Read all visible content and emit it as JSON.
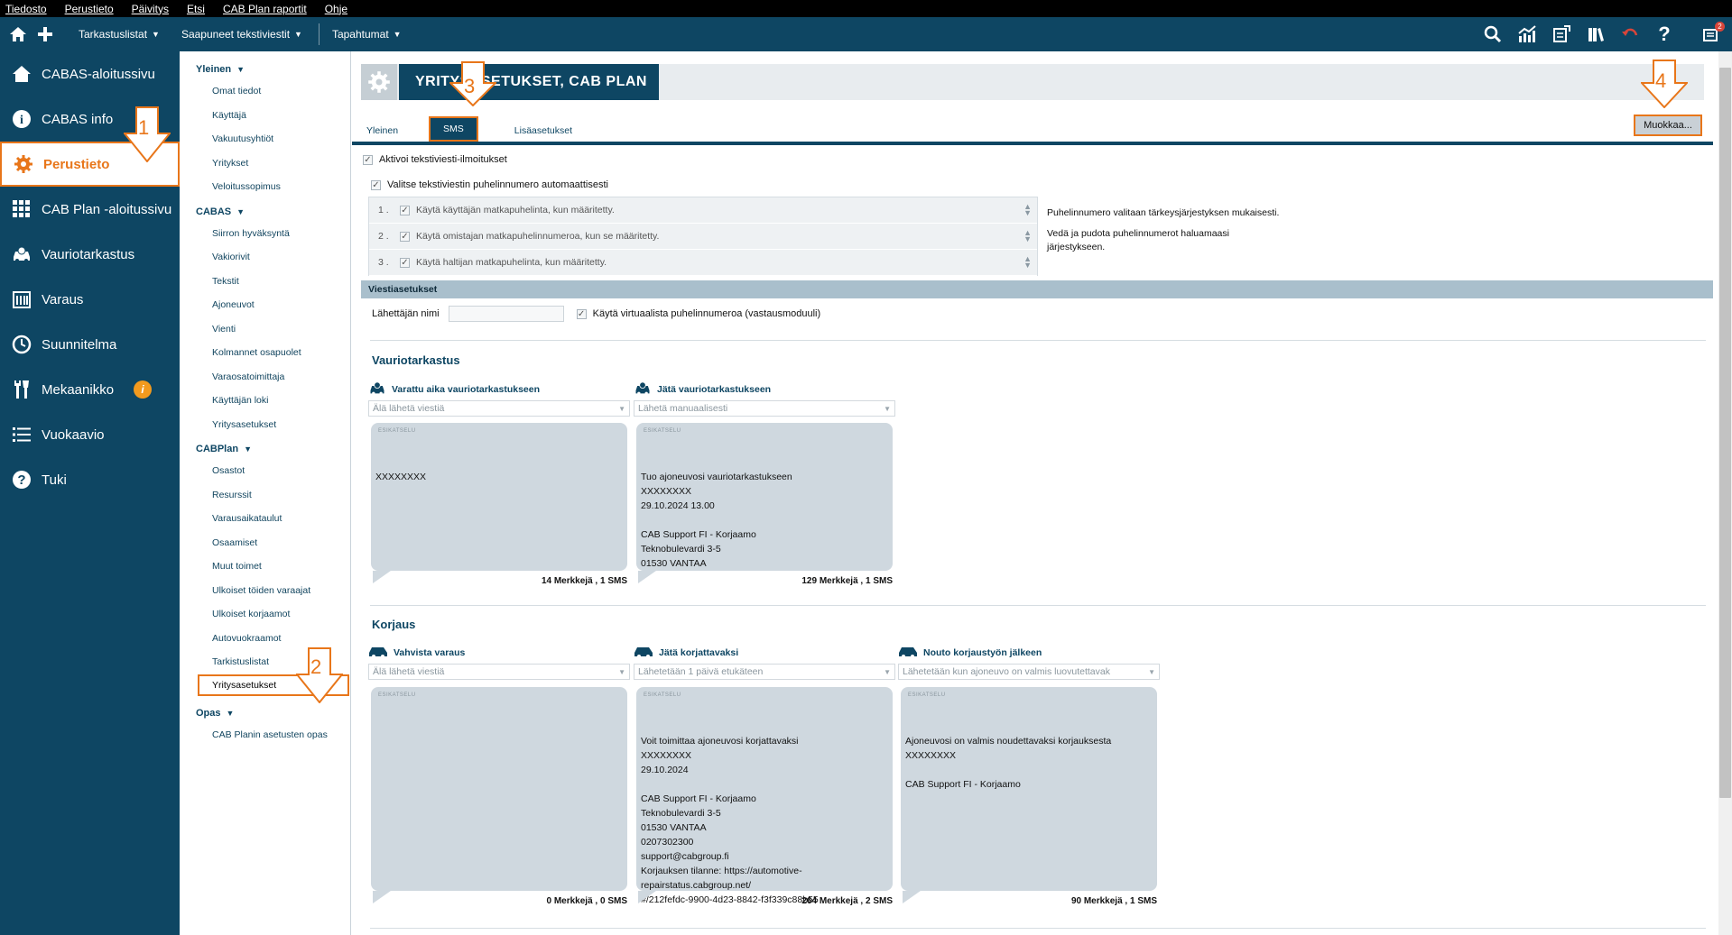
{
  "menubar": [
    "Tiedosto",
    "Perustieto",
    "Päivitys",
    "Etsi",
    "CAB Plan raportit",
    "Ohje"
  ],
  "toolbar": {
    "dropdowns": [
      "Tarkastuslistat",
      "Saapuneet tekstiviestit",
      "Tapahtumat"
    ],
    "notification_count": "2",
    "icons_left": [
      "home-icon",
      "plus-icon"
    ],
    "icons_right": [
      "search-icon",
      "analytics-icon",
      "report-icon",
      "books-icon",
      "undo-icon",
      "help-icon",
      "messages-icon"
    ]
  },
  "sidebar": [
    {
      "label": "CABAS-aloitussivu",
      "icon": "house-icon"
    },
    {
      "label": "CABAS info",
      "icon": "info-icon"
    },
    {
      "label": "Perustieto",
      "icon": "gear-icon",
      "active": true
    },
    {
      "label": "CAB Plan -aloitussivu",
      "icon": "grid-icon"
    },
    {
      "label": "Vauriotarkastus",
      "icon": "car-damage-icon"
    },
    {
      "label": "Varaus",
      "icon": "calendar-icon"
    },
    {
      "label": "Suunnitelma",
      "icon": "clock-icon"
    },
    {
      "label": "Mekaanikko",
      "icon": "tools-icon",
      "badge": "i"
    },
    {
      "label": "Vuokaavio",
      "icon": "list-icon"
    },
    {
      "label": "Tuki",
      "icon": "help-circle-icon"
    }
  ],
  "subnav": [
    {
      "heading": "Yleinen",
      "items": [
        "Omat tiedot",
        "Käyttäjä",
        "Vakuutusyhtiöt",
        "Yritykset",
        "Veloitussopimus"
      ]
    },
    {
      "heading": "CABAS",
      "items": [
        "Siirron hyväksyntä",
        "Vakiorivit",
        "Tekstit",
        "Ajoneuvot",
        "Vienti",
        "Kolmannet osapuolet",
        "Varaosatoimittaja",
        "Käyttäjän loki",
        "Yritysasetukset"
      ]
    },
    {
      "heading": "CABPlan",
      "items": [
        "Osastot",
        "Resurssit",
        "Varausaikataulut",
        "Osaamiset",
        "Muut toimet",
        "Ulkoiset töiden varaajat",
        "Ulkoiset korjaamot",
        "Autovuokraamot",
        "Tarkistuslistat",
        "Yritysasetukset"
      ],
      "selected": "Yritysasetukset"
    },
    {
      "heading": "Opas",
      "items": [
        "CAB Planin asetusten opas"
      ]
    }
  ],
  "page": {
    "title": "YRITYSASETUKSET, CAB PLAN",
    "tabs": [
      "Yleinen",
      "SMS",
      "Lisäasetukset"
    ],
    "active_tab": "SMS",
    "edit_button": "Muokkaa...",
    "activate_sms": "Aktivoi tekstiviesti-ilmoitukset",
    "auto_phone": "Valitse tekstiviestin puhelinnumero automaattisesti",
    "priority": [
      {
        "n": "1 .",
        "text": "Käytä käyttäjän matkapuhelinta, kun määritetty."
      },
      {
        "n": "2 .",
        "text": "Käytä omistajan matkapuhelinnumeroa, kun se määritetty."
      },
      {
        "n": "3 .",
        "text": "Käytä haltijan matkapuhelinta, kun määritetty."
      }
    ],
    "priority_note": [
      "Puhelinnumero valitaan tärkeysjärjestyksen mukaisesti.",
      "Vedä ja pudota puhelinnumerot haluamaasi järjestykseen."
    ],
    "section_title": "Viestiasetukset",
    "sender_label": "Lähettäjän nimi",
    "sender_value": "",
    "virtual_number": "Käytä virtuaalista puhelinnumeroa (vastausmoduuli)",
    "preview_label": "ESIKATSELU"
  },
  "groups": [
    {
      "title": "Vauriotarkastus",
      "cards": [
        {
          "title": "Varattu aika vauriotarkastukseen",
          "icon": "car-damage-icon",
          "select": "Älä lähetä viestiä",
          "preview": "XXXXXXXX",
          "count": "14 Merkkejä , 1 SMS"
        },
        {
          "title": "Jätä vauriotarkastukseen",
          "icon": "car-damage-icon",
          "select": "Lähetä manuaalisesti",
          "preview": "Tuo ajoneuvosi vauriotarkastukseen\nXXXXXXXX\n29.10.2024 13.00\n\nCAB Support FI - Korjaamo\nTeknobulevardi 3-5\n01530 VANTAA",
          "count": "129 Merkkejä , 1 SMS"
        }
      ]
    },
    {
      "title": "Korjaus",
      "cards": [
        {
          "title": "Vahvista varaus",
          "icon": "car-icon",
          "select": "Älä lähetä viestiä",
          "preview": "",
          "count": "0 Merkkejä , 0 SMS"
        },
        {
          "title": "Jätä korjattavaksi",
          "icon": "car-icon",
          "select": "Lähetetään 1 päivä etukäteen",
          "preview": "Voit toimittaa ajoneuvosi korjattavaksi\nXXXXXXXX\n29.10.2024\n\nCAB Support FI - Korjaamo\nTeknobulevardi 3-5\n01530 VANTAA\n0207302300\nsupport@cabgroup.fi\nKorjauksen tilanne: https://automotive-\nrepairstatus.cabgroup.net/\n#/212fefdc-9900-4d23-8842-f3f339c88b55",
          "count": "264 Merkkejä , 2 SMS"
        },
        {
          "title": "Nouto korjaustyön jälkeen",
          "icon": "car-icon",
          "select": "Lähetetään kun ajoneuvo on valmis luovutettavak",
          "preview": "Ajoneuvosi on valmis noudettavaksi korjauksesta\nXXXXXXXX\n\nCAB Support FI - Korjaamo",
          "count": "90 Merkkejä , 1 SMS"
        }
      ]
    }
  ],
  "callouts": [
    "1",
    "2",
    "3",
    "4"
  ]
}
